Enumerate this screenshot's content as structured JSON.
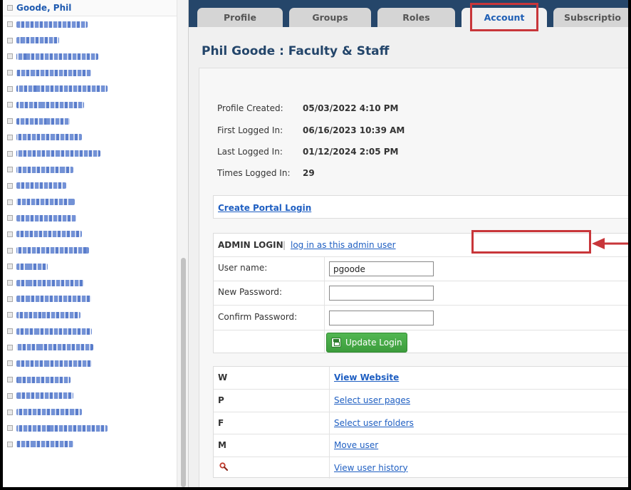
{
  "sidebar": {
    "selected_user": "Goode, Phil",
    "blurred_items": [
      {
        "w": 100
      },
      {
        "w": 60
      },
      {
        "w": 115
      },
      {
        "w": 105
      },
      {
        "w": 128
      },
      {
        "w": 95
      },
      {
        "w": 75
      },
      {
        "w": 92
      },
      {
        "w": 118
      },
      {
        "w": 80
      },
      {
        "w": 70
      },
      {
        "w": 82
      },
      {
        "w": 84
      },
      {
        "w": 92
      },
      {
        "w": 102
      },
      {
        "w": 44
      },
      {
        "w": 95
      },
      {
        "w": 105
      },
      {
        "w": 90
      },
      {
        "w": 106
      },
      {
        "w": 108
      },
      {
        "w": 106
      },
      {
        "w": 76
      },
      {
        "w": 80
      },
      {
        "w": 92
      },
      {
        "w": 128
      },
      {
        "w": 80
      }
    ]
  },
  "tabs": [
    {
      "label": "Profile"
    },
    {
      "label": "Groups"
    },
    {
      "label": "Roles"
    },
    {
      "label": "Account"
    },
    {
      "label": "Subscriptio"
    }
  ],
  "page": {
    "title": "Phil Goode : Faculty & Staff"
  },
  "account_info": {
    "profile_created_label": "Profile Created:",
    "profile_created_value": "05/03/2022 4:10 PM",
    "first_logged_in_label": "First Logged In:",
    "first_logged_in_value": "06/16/2023 10:39 AM",
    "last_logged_in_label": "Last Logged In:",
    "last_logged_in_value": "01/12/2024 2:05 PM",
    "times_logged_in_label": "Times Logged In:",
    "times_logged_in_value": "29"
  },
  "portal": {
    "create_portal_login": "Create Portal Login"
  },
  "admin_login": {
    "title": "ADMIN LOGIN",
    "separator": "|",
    "login_as_link": "log in as this admin user",
    "username_label": "User name:",
    "username_value": "pgoode",
    "new_password_label": "New Password:",
    "confirm_password_label": "Confirm Password:",
    "update_button": "Update Login"
  },
  "actions": [
    {
      "key": "W",
      "label": "View Website"
    },
    {
      "key": "P",
      "label": "Select user pages"
    },
    {
      "key": "F",
      "label": "Select user folders"
    },
    {
      "key": "M",
      "label": "Move user"
    },
    {
      "key": "",
      "label": "View user history",
      "icon": "search-icon"
    }
  ],
  "colors": {
    "highlight": "#c8363a",
    "tabbar": "#25466a",
    "link": "#1f5fc2",
    "button": "#3c9c3c"
  }
}
